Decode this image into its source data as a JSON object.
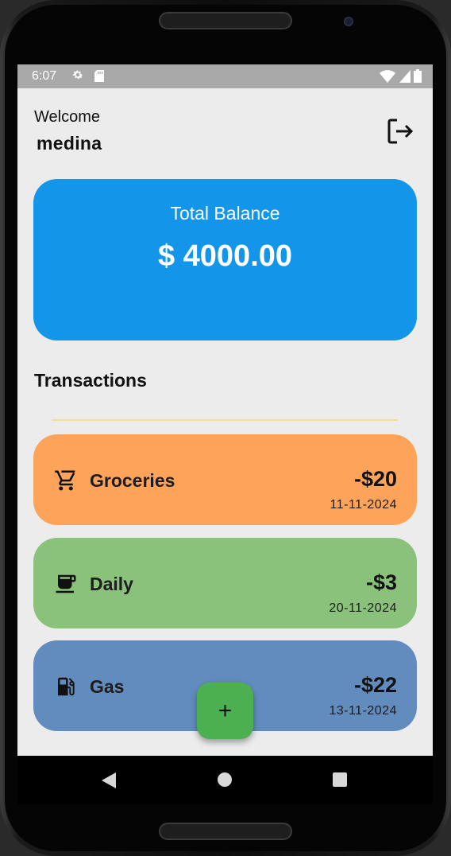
{
  "status_bar": {
    "time": "6:07",
    "icons": [
      "gear-icon",
      "sd-card-icon",
      "wifi-icon",
      "signal-icon",
      "battery-icon"
    ]
  },
  "header": {
    "welcome": "Welcome",
    "username": "medina",
    "logout_icon": "logout-icon"
  },
  "balance": {
    "label": "Total Balance",
    "amount": "$ 4000.00",
    "color": "#1395ea"
  },
  "transactions": {
    "title": "Transactions",
    "items": [
      {
        "name": "Groceries",
        "amount": "-$20",
        "date": "11-11-2024",
        "icon": "cart-icon",
        "color": "#fea35a"
      },
      {
        "name": "Daily",
        "amount": "-$3",
        "date": "20-11-2024",
        "icon": "coffee-cup-icon",
        "color": "#8bc27b"
      },
      {
        "name": "Gas",
        "amount": "-$22",
        "date": "13-11-2024",
        "icon": "gas-station-icon",
        "color": "#628cbe"
      }
    ]
  },
  "fab": {
    "label": "+",
    "color": "#4caf50"
  },
  "nav": {
    "icons": [
      "back-icon",
      "home-icon",
      "recent-apps-icon"
    ]
  }
}
